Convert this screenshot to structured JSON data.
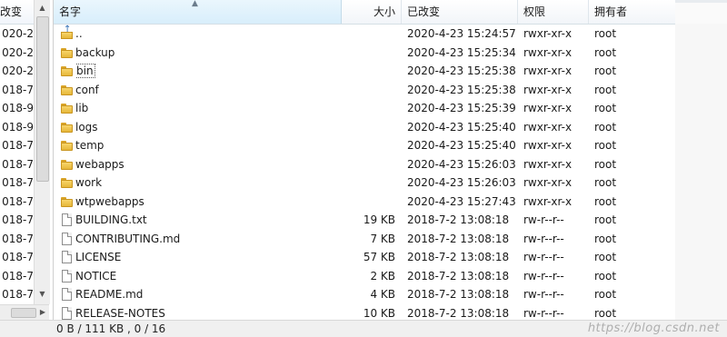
{
  "left_pane": {
    "header_label": "改变",
    "rows": [
      "020-2",
      "020-2",
      "020-2",
      "018-7",
      "018-9",
      "018-9",
      "018-7",
      "018-7",
      "018-7",
      "018-7",
      "018-7",
      "018-7",
      "018-7",
      "018-7",
      "018-7",
      "018-7"
    ]
  },
  "columns": {
    "name": "名字",
    "size": "大小",
    "modified": "已改变",
    "permissions": "权限",
    "owner": "拥有者"
  },
  "files": [
    {
      "name": "..",
      "type": "up",
      "size": "",
      "modified": "2020-4-23 15:24:57",
      "permissions": "rwxr-xr-x",
      "owner": "root"
    },
    {
      "name": "backup",
      "type": "folder",
      "size": "",
      "modified": "2020-4-23 15:25:34",
      "permissions": "rwxr-xr-x",
      "owner": "root"
    },
    {
      "name": "bin",
      "type": "folder",
      "size": "",
      "modified": "2020-4-23 15:25:38",
      "permissions": "rwxr-xr-x",
      "owner": "root",
      "focused": true
    },
    {
      "name": "conf",
      "type": "folder",
      "size": "",
      "modified": "2020-4-23 15:25:38",
      "permissions": "rwxr-xr-x",
      "owner": "root"
    },
    {
      "name": "lib",
      "type": "folder",
      "size": "",
      "modified": "2020-4-23 15:25:39",
      "permissions": "rwxr-xr-x",
      "owner": "root"
    },
    {
      "name": "logs",
      "type": "folder",
      "size": "",
      "modified": "2020-4-23 15:25:40",
      "permissions": "rwxr-xr-x",
      "owner": "root"
    },
    {
      "name": "temp",
      "type": "folder",
      "size": "",
      "modified": "2020-4-23 15:25:40",
      "permissions": "rwxr-xr-x",
      "owner": "root"
    },
    {
      "name": "webapps",
      "type": "folder",
      "size": "",
      "modified": "2020-4-23 15:26:03",
      "permissions": "rwxr-xr-x",
      "owner": "root"
    },
    {
      "name": "work",
      "type": "folder",
      "size": "",
      "modified": "2020-4-23 15:26:03",
      "permissions": "rwxr-xr-x",
      "owner": "root"
    },
    {
      "name": "wtpwebapps",
      "type": "folder",
      "size": "",
      "modified": "2020-4-23 15:27:43",
      "permissions": "rwxr-xr-x",
      "owner": "root"
    },
    {
      "name": "BUILDING.txt",
      "type": "file",
      "size": "19 KB",
      "modified": "2018-7-2 13:08:18",
      "permissions": "rw-r--r--",
      "owner": "root"
    },
    {
      "name": "CONTRIBUTING.md",
      "type": "file",
      "size": "7 KB",
      "modified": "2018-7-2 13:08:18",
      "permissions": "rw-r--r--",
      "owner": "root"
    },
    {
      "name": "LICENSE",
      "type": "file",
      "size": "57 KB",
      "modified": "2018-7-2 13:08:18",
      "permissions": "rw-r--r--",
      "owner": "root"
    },
    {
      "name": "NOTICE",
      "type": "file",
      "size": "2 KB",
      "modified": "2018-7-2 13:08:18",
      "permissions": "rw-r--r--",
      "owner": "root"
    },
    {
      "name": "README.md",
      "type": "file",
      "size": "4 KB",
      "modified": "2018-7-2 13:08:18",
      "permissions": "rw-r--r--",
      "owner": "root"
    },
    {
      "name": "RELEASE-NOTES",
      "type": "file",
      "size": "10 KB",
      "modified": "2018-7-2 13:08:18",
      "permissions": "rw-r--r--",
      "owner": "root"
    }
  ],
  "status": {
    "text": "0 B / 111 KB , 0 / 16"
  },
  "watermark": "https://blog.csdn.net"
}
